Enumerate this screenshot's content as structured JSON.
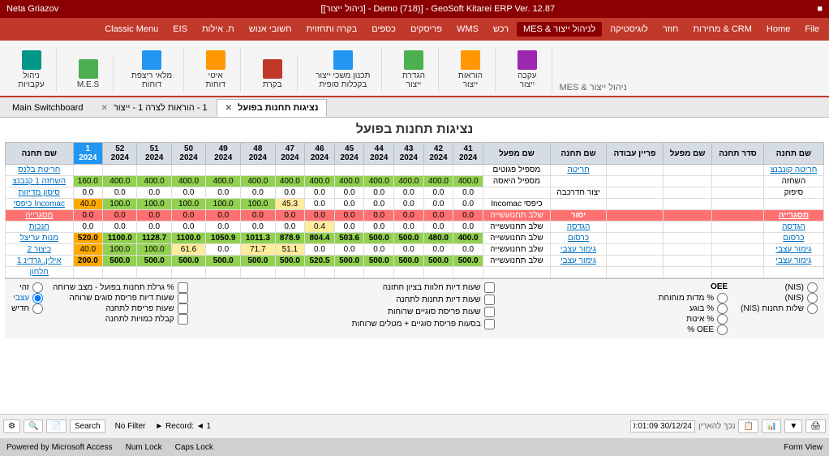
{
  "titleBar": {
    "title": "GeoSoft Kitarei ERP Ver. 12.87 - [Demo (718) - [ניהול ייצור]]",
    "user": "Neta Griazov"
  },
  "menuBar": {
    "items": [
      "File",
      "Home",
      "CRM & מחירות",
      "חוזר",
      "לוגיסטיקה",
      "לניהול ייצור & MES",
      "רכש",
      "WMS",
      "פריסקים",
      "כספים",
      "בקרה ותחזוית",
      "חשובי אנוש",
      "ת. אילות",
      "EIS",
      "Classic Menu"
    ]
  },
  "ribbon": {
    "groups": [
      {
        "label": "ניהול עקבויות",
        "buttons": [
          {
            "label": "ניהול\nעקבויות",
            "icon": "teal"
          }
        ]
      },
      {
        "label": "M.E.S",
        "buttons": [
          {
            "label": "M.E.S",
            "icon": "green"
          }
        ]
      },
      {
        "label": "מלאי ריצפת",
        "buttons": [
          {
            "label": "מלאי ריצפת\nדוחות",
            "icon": "blue"
          }
        ]
      },
      {
        "label": "איטי",
        "buttons": [
          {
            "label": "איטי\nדוחות",
            "icon": "orange"
          }
        ]
      },
      {
        "label": "בקרת",
        "buttons": [
          {
            "label": "בקרת",
            "icon": "red"
          }
        ]
      },
      {
        "label": "תכנון משכי ייצור",
        "buttons": [
          {
            "label": "תכנון משכי ייצור\nבקכלות סופית",
            "icon": "blue"
          }
        ]
      },
      {
        "label": "הגדרת ייצור",
        "buttons": [
          {
            "label": "הגדרת\nייצור",
            "icon": "green"
          }
        ]
      },
      {
        "label": "הוראות ייצור",
        "buttons": [
          {
            "label": "הוראות\nייצור",
            "icon": "orange"
          }
        ]
      },
      {
        "label": "עקכה",
        "buttons": [
          {
            "label": "עקכה\nייצור",
            "icon": "purple"
          }
        ]
      }
    ]
  },
  "tabs": [
    {
      "label": "Main Switchboard",
      "active": false
    },
    {
      "label": "1 - הוראות לצרה 1 - ייצור",
      "active": false
    },
    {
      "label": "נציגות תחנות בפועל",
      "active": true
    }
  ],
  "pageTitle": "נציגות תחנות בפועל",
  "tableHeaders": {
    "rightCols": [
      "שם תחנה",
      "סדר תחנה",
      "שם תחנה"
    ],
    "leftCols": [
      "שם מפעל",
      "פריין עבודה",
      "שם תחנה",
      "שם מפעל"
    ],
    "dateCols": [
      {
        "week": "41",
        "year": "2024"
      },
      {
        "week": "42",
        "year": "2024"
      },
      {
        "week": "43",
        "year": "2024"
      },
      {
        "week": "44",
        "year": "2024"
      },
      {
        "week": "45",
        "year": "2024"
      },
      {
        "week": "46",
        "year": "2024"
      },
      {
        "week": "47",
        "year": "2024"
      },
      {
        "week": "48",
        "year": "2024"
      },
      {
        "week": "49",
        "year": "2024"
      },
      {
        "week": "50",
        "year": "2024"
      },
      {
        "week": "51",
        "year": "2024"
      },
      {
        "week": "52",
        "year": "2024"
      },
      {
        "week": "1",
        "year": "2024",
        "highlighted": true
      }
    ]
  },
  "tableRows": [
    {
      "stationName": "חריטה קונבנצ",
      "stationOrder": "",
      "stationType": "חריטה",
      "factory": "",
      "workGroup": "",
      "label": "מספיל פגוטים",
      "values": [
        "",
        "",
        "",
        "",
        "",
        "",
        "",
        "",
        "",
        "",
        "",
        "",
        ""
      ],
      "rowClass": "normal"
    },
    {
      "stationName": "השחזה",
      "values": [
        "400.0",
        "400.0",
        "400.0",
        "400.0",
        "400.0",
        "400.0",
        "400.0",
        "400.0",
        "400.0",
        "400.0",
        "400.0",
        "400.0",
        "160.0"
      ],
      "label": "מספיל היאסה",
      "rowClass": "green-row"
    },
    {
      "stationName": "סיפוק",
      "values": [
        "0.0",
        "0.0",
        "0.0",
        "0.0",
        "0.0",
        "0.0",
        "0.0",
        "0.0",
        "0.0",
        "0.0",
        "0.0",
        "0.0",
        "0.0"
      ],
      "label": "יצור חדרכבה",
      "rowClass": "normal"
    },
    {
      "stationName": "",
      "values": [
        "0.0",
        "0.0",
        "0.0",
        "0.0",
        "0.0",
        "0.0",
        "45.3",
        "100.0",
        "100.0",
        "100.0",
        "100.0",
        "100.0",
        "40.0"
      ],
      "label": "כיפסי Incomac",
      "rowClass": "yellow-row"
    },
    {
      "stationName": "מסגרייה",
      "stationType": "יסור",
      "label": "שלב תחנועשייה",
      "values": [
        "0.0",
        "0.0",
        "0.0",
        "0.0",
        "0.0",
        "0.0",
        "0.0",
        "0.0",
        "0.0",
        "0.0",
        "0.0",
        "0.0",
        "0.0"
      ],
      "rowClass": "red-section"
    },
    {
      "stationName": "הגדסה",
      "values": [
        "0.0",
        "0.0",
        "0.0",
        "0.0",
        "0.0",
        "0.4",
        "0.0",
        "0.0",
        "0.0",
        "0.0",
        "0.0",
        "0.0",
        "0.0"
      ],
      "label": "שלב תחנועשייה",
      "rowClass": "yellow-cell"
    },
    {
      "stationName": "כרסום",
      "stationType": "כרסום",
      "label": "שלב תחנועשייה",
      "values": [
        "400.0",
        "480.0",
        "500.0",
        "500.0",
        "503.6",
        "804.4",
        "878.9",
        "1011.3",
        "1050.9",
        "1100.0",
        "1128.7",
        "1100.0",
        "520.0"
      ],
      "rowClass": "totals-row"
    },
    {
      "stationName": "גימור עצבי",
      "stationType": "גימור עצבי",
      "label": "שלב תחנועשייה",
      "values": [
        "0.0",
        "0.0",
        "0.0",
        "0.0",
        "0.0",
        "0.0",
        "51.1",
        "71.7",
        "0.0",
        "61.6",
        "100.0",
        "100.0",
        "40.0"
      ],
      "rowClass": "mixed"
    },
    {
      "stationName": "גימור עצבי",
      "stationType": "גימור עצבי",
      "label": "שלב תחנועשייה",
      "values": [
        "500.0",
        "500.0",
        "500.0",
        "500.0",
        "500.0",
        "520.5",
        "500.0",
        "500.0",
        "500.0",
        "500.0",
        "500.0",
        "500.0",
        "200.0"
      ],
      "rowClass": "green-totals"
    },
    {
      "stationName": "",
      "values": [
        "",
        "",
        "",
        "",
        "",
        "",
        "",
        "",
        "",
        "",
        "",
        "",
        ""
      ],
      "label": "",
      "rowClass": "normal"
    }
  ],
  "bottomPanel": {
    "leftSection": {
      "title": "OEE",
      "checkboxes": [
        {
          "label": "% מדות מוחוחת",
          "checked": false
        },
        {
          "label": "% בוגע",
          "checked": false
        },
        {
          "label": "% אינות",
          "checked": false
        },
        {
          "label": "OEE %",
          "checked": false
        }
      ],
      "nisCheckboxes": [
        {
          "label": "(NIS)",
          "checked": false
        },
        {
          "label": "(NIS)",
          "checked": false
        },
        {
          "label": "שלות תחנות\n(NIS)",
          "checked": false
        }
      ]
    },
    "middleSection": {
      "checkboxes": [
        {
          "label": "שעות דיות חלוות בציון חתונה",
          "checked": false
        },
        {
          "label": "שעות דיות תחנות לתחנה",
          "checked": false
        },
        {
          "label": "שעות פריסת סוגיים שרוחות",
          "checked": false
        },
        {
          "label": "בסעות פריסת סוגיים + מטלים\nשרוחות",
          "checked": false
        }
      ]
    },
    "rightSection": {
      "label": "זהי",
      "radioActive": "עצבי",
      "checkboxes": [
        {
          "label": "% גרלת תחנות בפועל - מצב שרוחה",
          "checked": false
        },
        {
          "label": "שעות דיות פריסת סוגים שרוחה",
          "checked": false
        },
        {
          "label": "שעות פריסת לתחנה",
          "checked": false
        },
        {
          "label": "קבלת כמויות לתחנה",
          "checked": false
        }
      ],
      "radioOptions": [
        "זהי",
        "עצבי",
        "חדיש"
      ]
    }
  },
  "toolbar": {
    "navDate": "30/12/24 20:01:09",
    "recordInfo": "Record: 1",
    "noFilter": "No Filter",
    "search": "Search"
  },
  "statusBar": {
    "formView": "Form View",
    "capsLock": "Caps Lock",
    "numLock": "Num Lock",
    "poweredBy": "Powered by Microsoft Access"
  }
}
